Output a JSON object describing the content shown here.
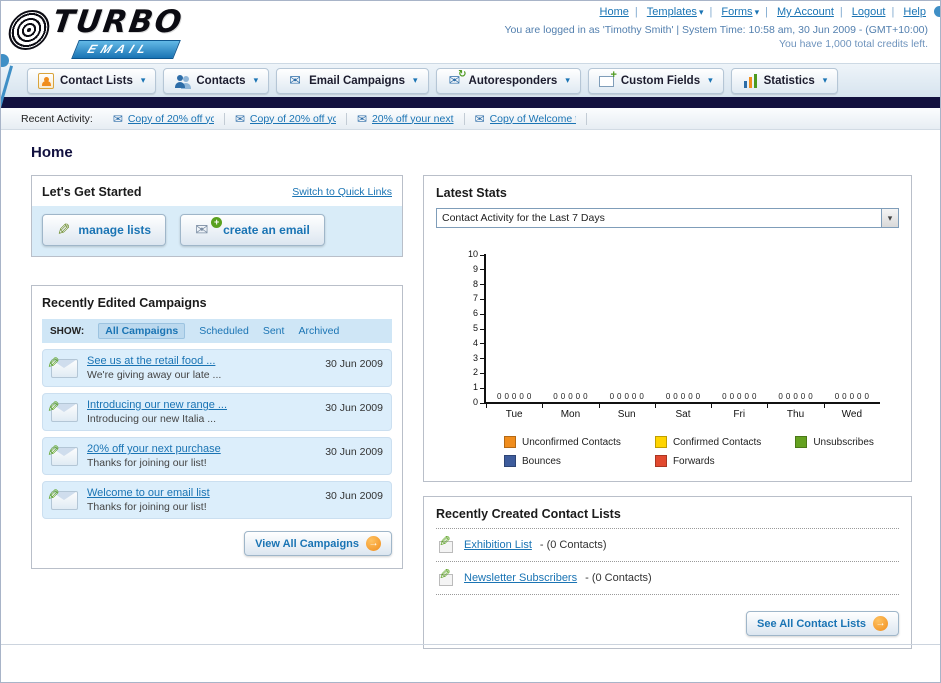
{
  "icons": {
    "chevron_down": "▾",
    "envelope": "✉",
    "pencil": "✎",
    "plus": "+",
    "arrow_right": "→",
    "refresh": "↻"
  },
  "colors": {
    "accent_blue": "#1a74b4",
    "dark_navy": "#13113f",
    "orange": "#f08d1d"
  },
  "header": {
    "logo_primary": "TURBO",
    "logo_secondary": "EMAIL",
    "links": [
      {
        "label": "Home"
      },
      {
        "label": "Templates"
      },
      {
        "label": "Forms"
      },
      {
        "label": "My Account"
      },
      {
        "label": "Logout"
      },
      {
        "label": "Help"
      }
    ],
    "login_info": "You are logged in as 'Timothy Smith' | System Time: 10:58 am, 30 Jun 2009 - (GMT+10:00)",
    "credits_info": "You have 1,000 total credits left."
  },
  "nav": {
    "tabs": [
      {
        "label": "Contact Lists"
      },
      {
        "label": "Contacts"
      },
      {
        "label": "Email Campaigns"
      },
      {
        "label": "Autoresponders"
      },
      {
        "label": "Custom Fields"
      },
      {
        "label": "Statistics"
      }
    ]
  },
  "recent_activity": {
    "label": "Recent Activity:",
    "items": [
      "Copy of 20% off yc",
      "Copy of 20% off yc",
      "20% off your next",
      "Copy of Welcome tc"
    ]
  },
  "page": {
    "title": "Home"
  },
  "get_started": {
    "title": "Let's Get Started",
    "switch_link": "Switch to Quick Links",
    "manage_lists_label": "manage lists",
    "create_email_label": "create an email"
  },
  "campaigns": {
    "title": "Recently Edited Campaigns",
    "show_label": "SHOW:",
    "filters": [
      "All Campaigns",
      "Scheduled",
      "Sent",
      "Archived"
    ],
    "items": [
      {
        "title": "See us at the retail food ...",
        "subtitle": "We're giving away our late ...",
        "date": "30 Jun 2009"
      },
      {
        "title": "Introducing our new range ...",
        "subtitle": "Introducing our new Italia ...",
        "date": "30 Jun 2009"
      },
      {
        "title": "20% off your next purchase",
        "subtitle": "Thanks for joining our list!",
        "date": "30 Jun 2009"
      },
      {
        "title": "Welcome to our email list",
        "subtitle": "Thanks for joining our list!",
        "date": "30 Jun 2009"
      }
    ],
    "view_all_label": "View All Campaigns"
  },
  "stats": {
    "title": "Latest Stats",
    "dropdown_value": "Contact Activity for the Last 7 Days"
  },
  "chart_data": {
    "type": "bar",
    "title": "Contact Activity for the Last 7 Days",
    "categories": [
      "Tue",
      "Mon",
      "Sun",
      "Sat",
      "Fri",
      "Thu",
      "Wed"
    ],
    "series": [
      {
        "name": "Unconfirmed Contacts",
        "color": "#f08d1d",
        "values": [
          0,
          0,
          0,
          0,
          0,
          0,
          0
        ]
      },
      {
        "name": "Confirmed Contacts",
        "color": "#ffd400",
        "values": [
          0,
          0,
          0,
          0,
          0,
          0,
          0
        ]
      },
      {
        "name": "Unsubscribes",
        "color": "#64a120",
        "values": [
          0,
          0,
          0,
          0,
          0,
          0,
          0
        ]
      },
      {
        "name": "Bounces",
        "color": "#3e5c9c",
        "values": [
          0,
          0,
          0,
          0,
          0,
          0,
          0
        ]
      },
      {
        "name": "Forwards",
        "color": "#e2492f",
        "values": [
          0,
          0,
          0,
          0,
          0,
          0,
          0
        ]
      }
    ],
    "ylim": [
      0,
      10
    ],
    "y_tick_step": 1,
    "value_labels_shown": true,
    "grid": false,
    "legend_position": "bottom"
  },
  "contact_lists": {
    "title": "Recently Created Contact Lists",
    "items": [
      {
        "name": "Exhibition List",
        "count": "- (0 Contacts)"
      },
      {
        "name": "Newsletter Subscribers",
        "count": "- (0 Contacts)"
      }
    ],
    "see_all_label": "See All Contact Lists"
  }
}
